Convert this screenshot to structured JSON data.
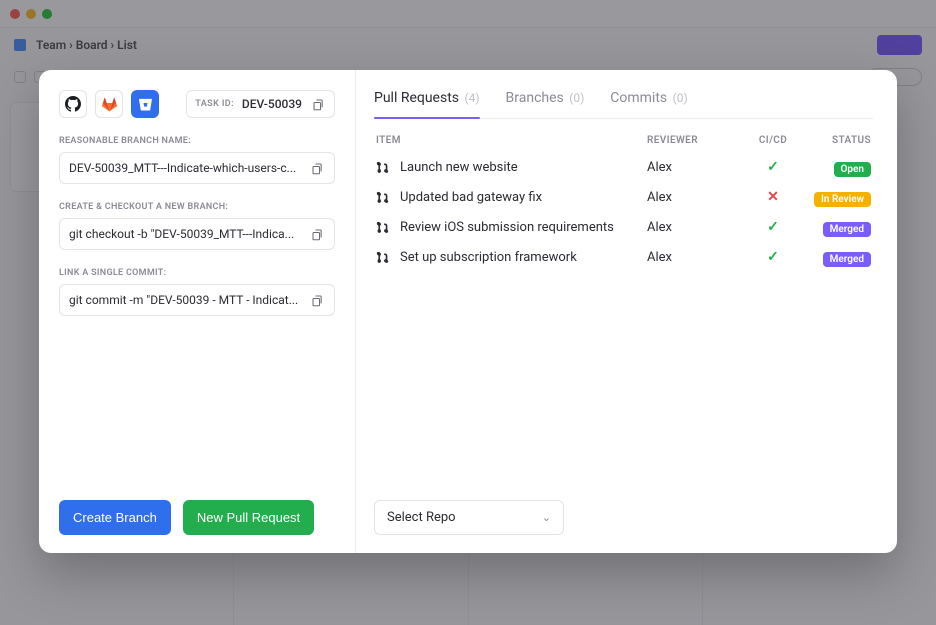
{
  "background": {
    "breadcrumb": "Team  ›  Board  ›  List"
  },
  "task_id": {
    "label": "TASK ID:",
    "value": "DEV-50039"
  },
  "fields": {
    "branch_name": {
      "label": "REASONABLE BRANCH NAME:",
      "value": "DEV-50039_MTT---Indicate-which-users-c..."
    },
    "checkout": {
      "label": "CREATE & CHECKOUT A NEW BRANCH:",
      "value": "git checkout -b \"DEV-50039_MTT---Indica..."
    },
    "commit": {
      "label": "LINK A SINGLE COMMIT:",
      "value": "git commit -m \"DEV-50039 - MTT - Indicat..."
    }
  },
  "actions": {
    "create_branch": "Create Branch",
    "new_pr": "New Pull Request"
  },
  "tabs": {
    "pull_requests": {
      "label": "Pull Requests",
      "count": "(4)"
    },
    "branches": {
      "label": "Branches",
      "count": "(0)"
    },
    "commits": {
      "label": "Commits",
      "count": "(0)"
    }
  },
  "table": {
    "headers": {
      "item": "ITEM",
      "reviewer": "REVIEWER",
      "cicd": "CI/CD",
      "status": "STATUS"
    },
    "rows": [
      {
        "title": "Launch new website",
        "reviewer": "Alex",
        "ci": "pass",
        "status": "Open",
        "status_class": "b-open"
      },
      {
        "title": "Updated bad gateway fix",
        "reviewer": "Alex",
        "ci": "fail",
        "status": "In Review",
        "status_class": "b-review"
      },
      {
        "title": "Review iOS submission requirements",
        "reviewer": "Alex",
        "ci": "pass",
        "status": "Merged",
        "status_class": "b-merged"
      },
      {
        "title": "Set up subscription framework",
        "reviewer": "Alex",
        "ci": "pass",
        "status": "Merged",
        "status_class": "b-merged"
      }
    ]
  },
  "select_repo": "Select Repo"
}
